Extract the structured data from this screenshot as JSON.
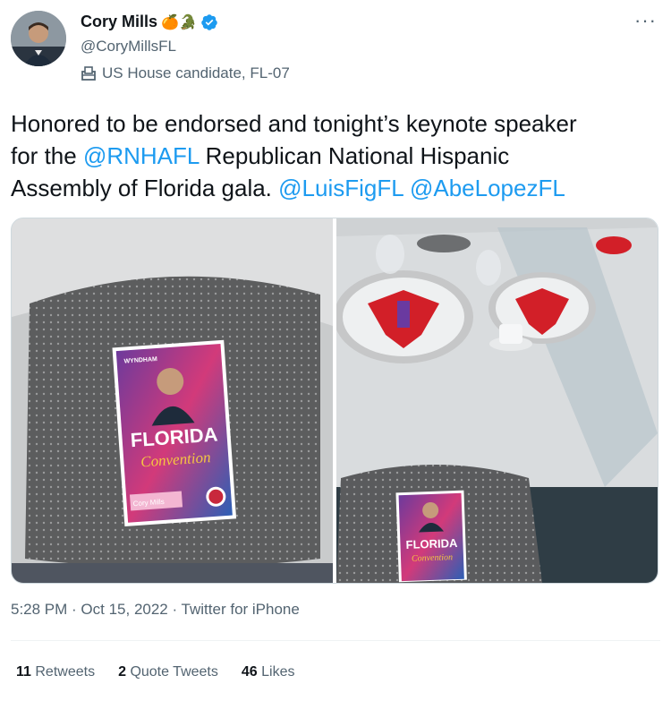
{
  "author": {
    "name": "Cory Mills",
    "emoji": "🍊🐊",
    "handle": "@CoryMillsFL",
    "label": "US House candidate, FL-07"
  },
  "more_label": "···",
  "tweet": {
    "line1": "Honored to be endorsed and tonight’s keynote speaker",
    "for_the": "for the ",
    "mention_rnhafl": "@RNHAFL",
    "mid_text": " Republican National Hispanic",
    "assembly": "Assembly of Florida gala. ",
    "mention_luis": "@LuisFigFL",
    "space": " ",
    "mention_abe": "@AbeLopezFL"
  },
  "media": {
    "left": {
      "brand": "WYNDHAM",
      "florida": "FLORIDA",
      "convention": "Convention",
      "name_tag": "Cory Mills"
    },
    "right": {
      "florida": "FLORIDA",
      "convention": "Convention"
    }
  },
  "meta": {
    "time": "5:28 PM · Oct 15, 2022 · Twitter for iPhone"
  },
  "stats": {
    "retweets_count": "11",
    "retweets_label": "Retweets",
    "quotes_count": "2",
    "quotes_label": "Quote Tweets",
    "likes_count": "46",
    "likes_label": "Likes"
  },
  "colors": {
    "link": "#1d9bf0",
    "secondary_text": "#536471",
    "primary_text": "#0f1419"
  }
}
